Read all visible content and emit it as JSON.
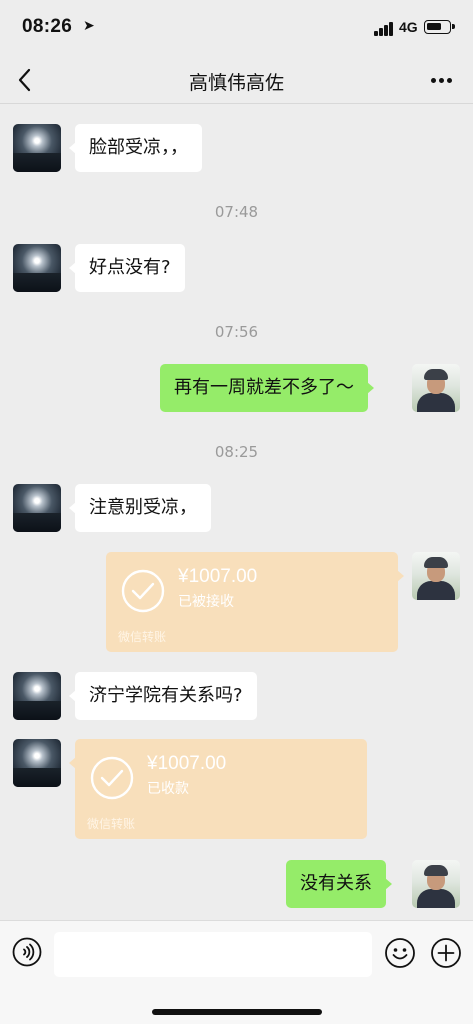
{
  "status_bar": {
    "time": "08:26",
    "network": "4G"
  },
  "header": {
    "title": "高慎伟高佐"
  },
  "messages": {
    "m1": "脸部受凉，，",
    "t1": "07:48",
    "m2": "好点没有?",
    "t2": "07:56",
    "m3": "再有一周就差不多了～",
    "t3": "08:25",
    "m4": "注意别受凉，",
    "tr1": {
      "amount": "¥1007.00",
      "state": "已被接收",
      "footer": "微信转账"
    },
    "m5": "济宁学院有关系吗?",
    "tr2": {
      "amount": "¥1007.00",
      "state": "已收款",
      "footer": "微信转账"
    },
    "m6": "没有关系"
  },
  "input": {
    "placeholder": ""
  },
  "icons": {
    "back": "chevron-left-icon",
    "more": "more-dots-icon",
    "voice": "voice-icon",
    "emoji": "emoji-icon",
    "plus": "plus-icon",
    "check": "check-circle-icon",
    "location": "location-arrow-icon",
    "signal": "signal-icon",
    "battery": "battery-icon"
  },
  "colors": {
    "background": "#ededed",
    "sent_bubble": "#95ec69",
    "transfer_card": "#f8dfbb",
    "received_bubble": "#ffffff"
  }
}
